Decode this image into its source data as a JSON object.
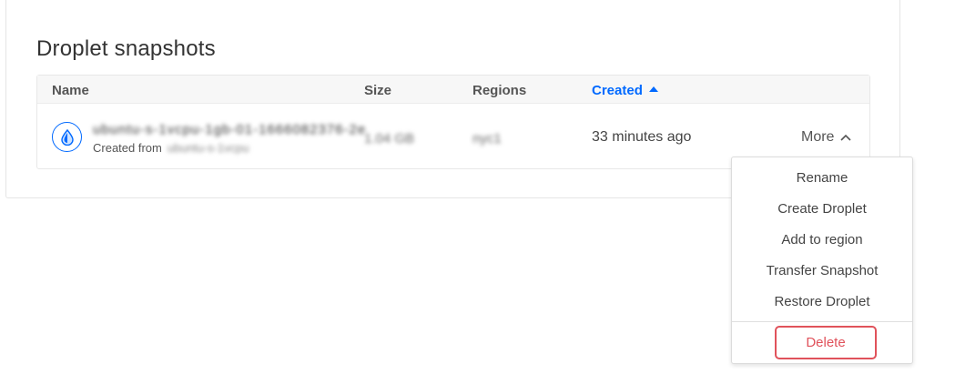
{
  "section": {
    "title": "Droplet snapshots"
  },
  "table": {
    "headers": {
      "name": "Name",
      "size": "Size",
      "regions": "Regions",
      "created": "Created"
    },
    "rows": [
      {
        "name": "ubuntu-s-1vcpu-1gb-01-1666082376-2e",
        "created_from_label": "Created from",
        "created_from_value": "ubuntu-s-1vcpu",
        "size": "1.04 GB",
        "regions": "nyc1",
        "created": "33 minutes ago",
        "more_label": "More"
      }
    ]
  },
  "menu": {
    "items": [
      "Rename",
      "Create Droplet",
      "Add to region",
      "Transfer Snapshot",
      "Restore Droplet"
    ],
    "delete_label": "Delete"
  },
  "colors": {
    "accent": "#0069ff",
    "danger": "#e0525b"
  }
}
